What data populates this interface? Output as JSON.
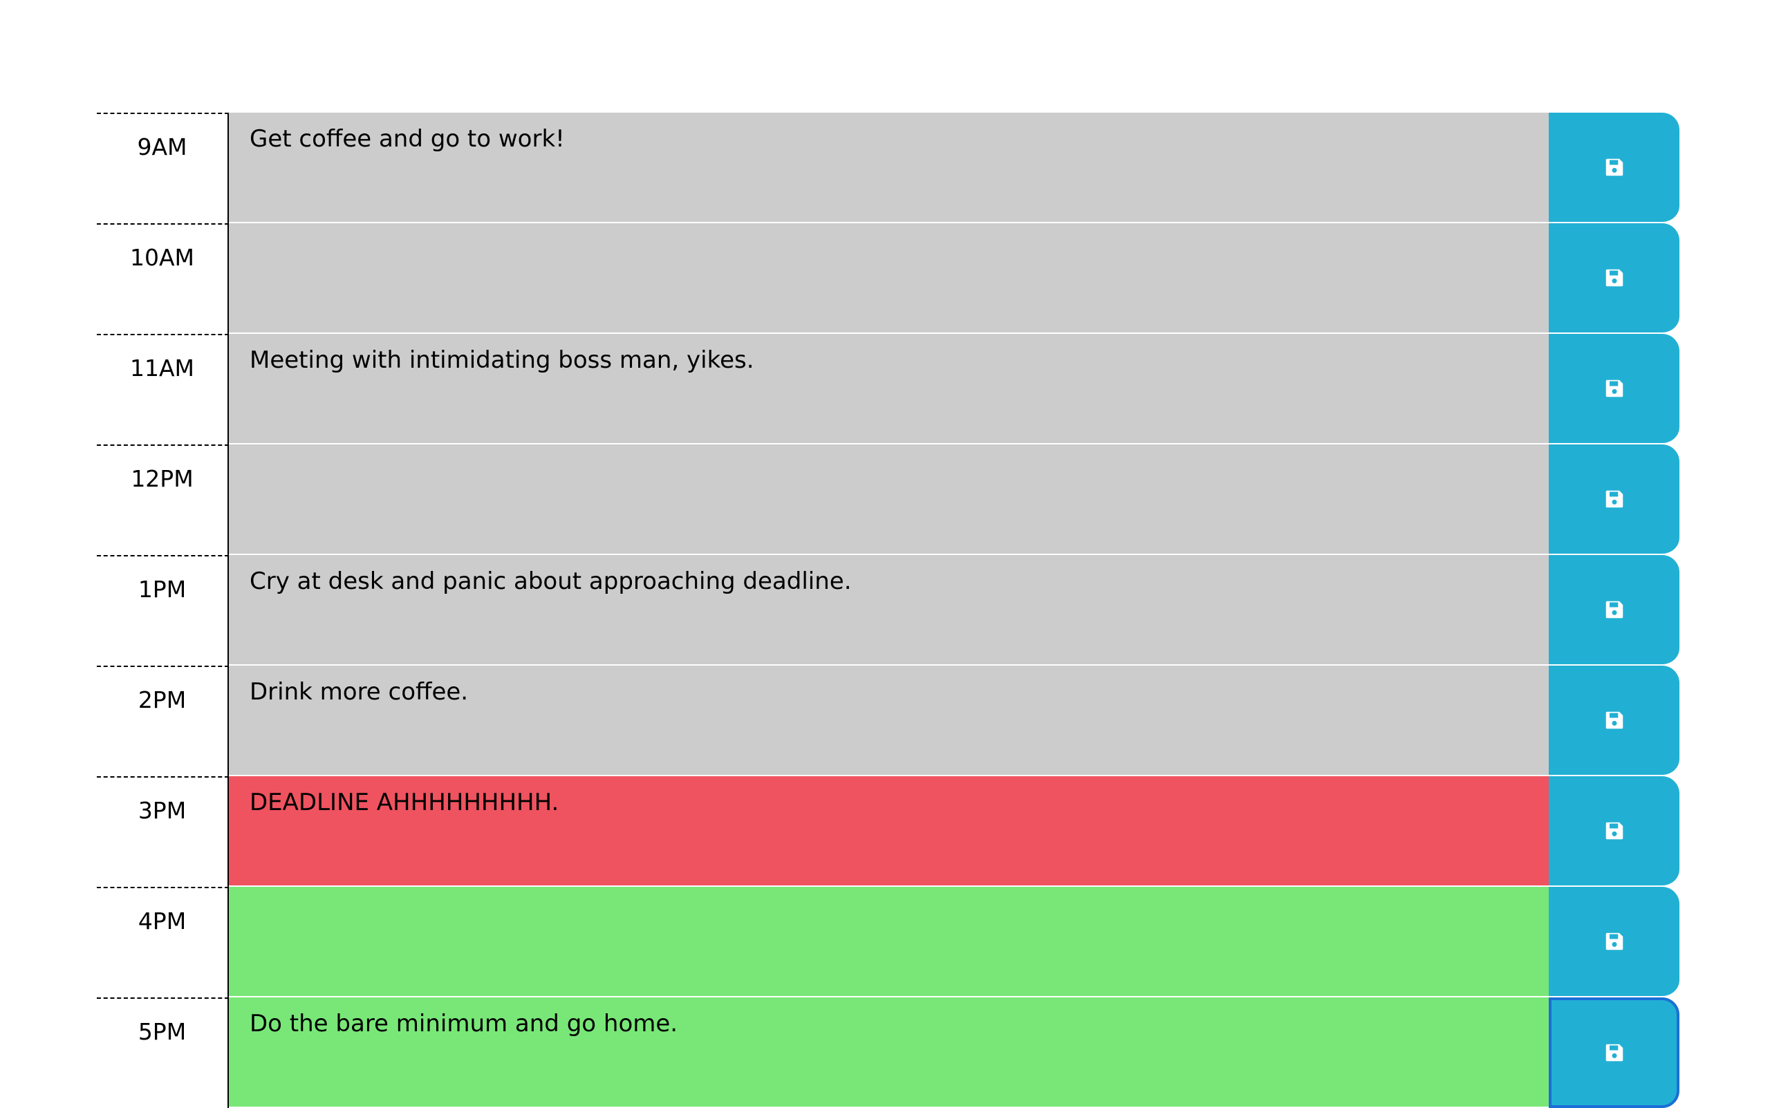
{
  "colors": {
    "past": "#cccccc",
    "present": "#ef535f",
    "future": "#79e778",
    "save_button": "#21b0d4",
    "focus_ring": "#1a6fd6"
  },
  "save_icon": "floppy-disk-icon",
  "hours": [
    {
      "label": "9AM",
      "text": "Get coffee and go to work!",
      "state": "past"
    },
    {
      "label": "10AM",
      "text": "",
      "state": "past"
    },
    {
      "label": "11AM",
      "text": "Meeting with intimidating boss man, yikes.",
      "state": "past"
    },
    {
      "label": "12PM",
      "text": "",
      "state": "past"
    },
    {
      "label": "1PM",
      "text": "Cry at desk and panic about approaching deadline.",
      "state": "past"
    },
    {
      "label": "2PM",
      "text": "Drink more coffee.",
      "state": "past"
    },
    {
      "label": "3PM",
      "text": "DEADLINE AHHHHHHHHH.",
      "state": "present"
    },
    {
      "label": "4PM",
      "text": "",
      "state": "future"
    },
    {
      "label": "5PM",
      "text": "Do the bare minimum and go home.",
      "state": "future"
    }
  ]
}
